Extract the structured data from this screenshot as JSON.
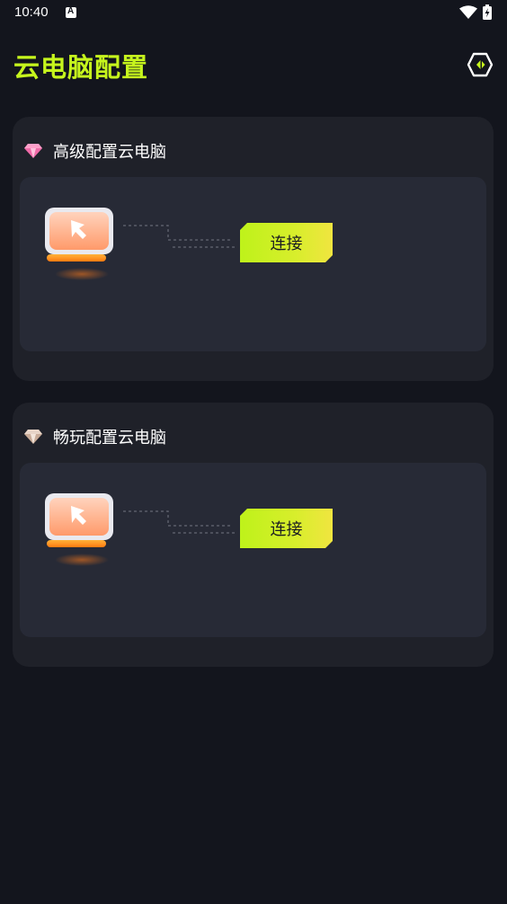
{
  "status_bar": {
    "time": "10:40",
    "notification_icon": "a-letter-icon",
    "wifi_icon": "wifi-icon",
    "battery_icon": "battery-charging-icon"
  },
  "header": {
    "title": "云电脑配置",
    "settings_icon": "hexagon-arrows-icon",
    "accent_color": "#c6f51d"
  },
  "cards": [
    {
      "title": "高级配置云电脑",
      "gem_icon": "pink-diamond-icon",
      "gem_color": "#f06aa8",
      "device_icon": "computer-cursor-icon",
      "connect_label": "连接"
    },
    {
      "title": "畅玩配置云电脑",
      "gem_icon": "beige-diamond-icon",
      "gem_color": "#d9c3b3",
      "device_icon": "computer-cursor-icon",
      "connect_label": "连接"
    }
  ],
  "colors": {
    "background": "#13151d",
    "card": "#1f2129",
    "card_inner": "#272a36",
    "button_start": "#bef21a",
    "button_end": "#f0e540"
  }
}
